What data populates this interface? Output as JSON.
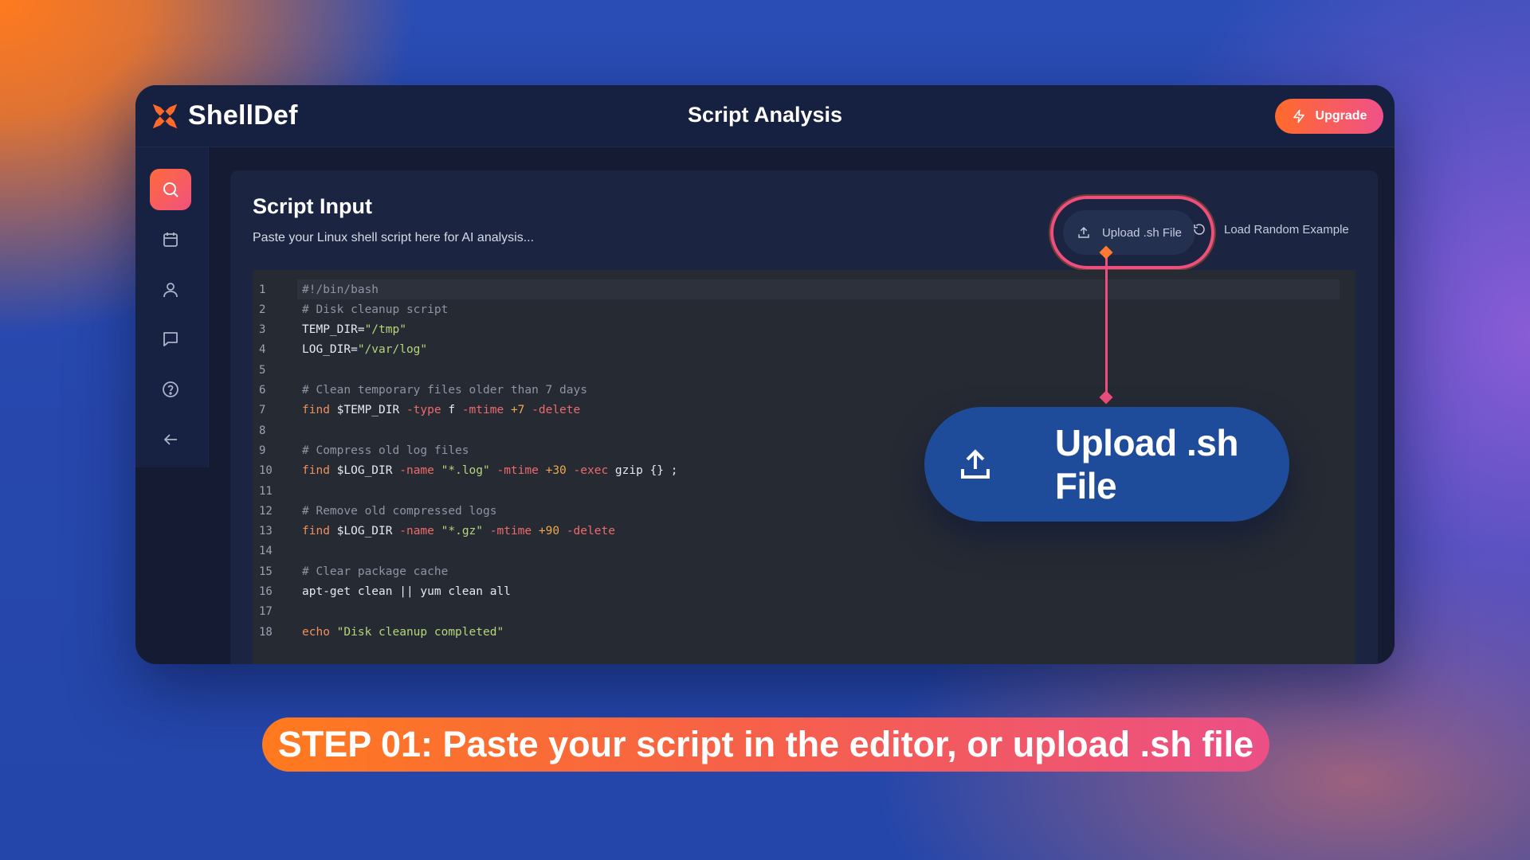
{
  "app": {
    "brand_name": "ShellDef",
    "logo_icon": "shelldef-logo-icon",
    "page_title": "Script Analysis",
    "upgrade_label": "Upgrade",
    "accent_color": "#ff6a2b",
    "accent_color_2": "#f0518a"
  },
  "sidebar": {
    "items": [
      {
        "name": "search",
        "icon": "search-icon",
        "active": true
      },
      {
        "name": "calendar",
        "icon": "calendar-icon",
        "active": false
      },
      {
        "name": "user",
        "icon": "user-icon",
        "active": false
      },
      {
        "name": "messages",
        "icon": "chat-icon",
        "active": false
      },
      {
        "name": "help",
        "icon": "help-icon",
        "active": false
      },
      {
        "name": "back",
        "icon": "arrow-left-icon",
        "active": false
      }
    ]
  },
  "card": {
    "title": "Script Input",
    "subtitle": "Paste your Linux shell script here for AI analysis...",
    "upload_label": "Upload .sh File",
    "load_random_label": "Load Random Example"
  },
  "editor": {
    "lines": [
      {
        "n": "1",
        "tokens": [
          [
            "comment",
            "#!/bin/bash"
          ]
        ]
      },
      {
        "n": "2",
        "tokens": [
          [
            "comment",
            "# Disk cleanup script"
          ]
        ]
      },
      {
        "n": "3",
        "tokens": [
          [
            "plain",
            "TEMP_DIR="
          ],
          [
            "string",
            "\"/tmp\""
          ]
        ]
      },
      {
        "n": "4",
        "tokens": [
          [
            "plain",
            "LOG_DIR="
          ],
          [
            "string",
            "\"/var/log\""
          ]
        ]
      },
      {
        "n": "5",
        "tokens": []
      },
      {
        "n": "6",
        "tokens": [
          [
            "comment",
            "# Clean temporary files older than 7 days"
          ]
        ]
      },
      {
        "n": "7",
        "tokens": [
          [
            "keyword",
            "find"
          ],
          [
            "plain",
            " $TEMP_DIR "
          ],
          [
            "flag",
            "-type"
          ],
          [
            "plain",
            " f "
          ],
          [
            "flag",
            "-mtime"
          ],
          [
            "plain",
            " "
          ],
          [
            "num",
            "+7"
          ],
          [
            "plain",
            " "
          ],
          [
            "flag",
            "-delete"
          ]
        ]
      },
      {
        "n": "8",
        "tokens": []
      },
      {
        "n": "9",
        "tokens": [
          [
            "comment",
            "# Compress old log files"
          ]
        ]
      },
      {
        "n": "10",
        "tokens": [
          [
            "keyword",
            "find"
          ],
          [
            "plain",
            " $LOG_DIR "
          ],
          [
            "flag",
            "-name"
          ],
          [
            "plain",
            " "
          ],
          [
            "string",
            "\"*.log\""
          ],
          [
            "plain",
            " "
          ],
          [
            "flag",
            "-mtime"
          ],
          [
            "plain",
            " "
          ],
          [
            "num",
            "+30"
          ],
          [
            "plain",
            " "
          ],
          [
            "flag",
            "-exec"
          ],
          [
            "plain",
            " gzip {} ;"
          ]
        ]
      },
      {
        "n": "11",
        "tokens": []
      },
      {
        "n": "12",
        "tokens": [
          [
            "comment",
            "# Remove old compressed logs"
          ]
        ]
      },
      {
        "n": "13",
        "tokens": [
          [
            "keyword",
            "find"
          ],
          [
            "plain",
            " $LOG_DIR "
          ],
          [
            "flag",
            "-name"
          ],
          [
            "plain",
            " "
          ],
          [
            "string",
            "\"*.gz\""
          ],
          [
            "plain",
            " "
          ],
          [
            "flag",
            "-mtime"
          ],
          [
            "plain",
            " "
          ],
          [
            "num",
            "+90"
          ],
          [
            "plain",
            " "
          ],
          [
            "flag",
            "-delete"
          ]
        ]
      },
      {
        "n": "14",
        "tokens": []
      },
      {
        "n": "15",
        "tokens": [
          [
            "comment",
            "# Clear package cache"
          ]
        ]
      },
      {
        "n": "16",
        "tokens": [
          [
            "plain",
            "apt-get clean || yum clean all"
          ]
        ]
      },
      {
        "n": "17",
        "tokens": []
      },
      {
        "n": "18",
        "tokens": [
          [
            "keyword",
            "echo"
          ],
          [
            "plain",
            " "
          ],
          [
            "string",
            "\"Disk cleanup completed\""
          ]
        ]
      }
    ]
  },
  "callout": {
    "label": "Upload .sh File",
    "icon": "upload-icon"
  },
  "step_banner": {
    "text": "STEP 01: Paste your script in the editor, or upload .sh file"
  }
}
